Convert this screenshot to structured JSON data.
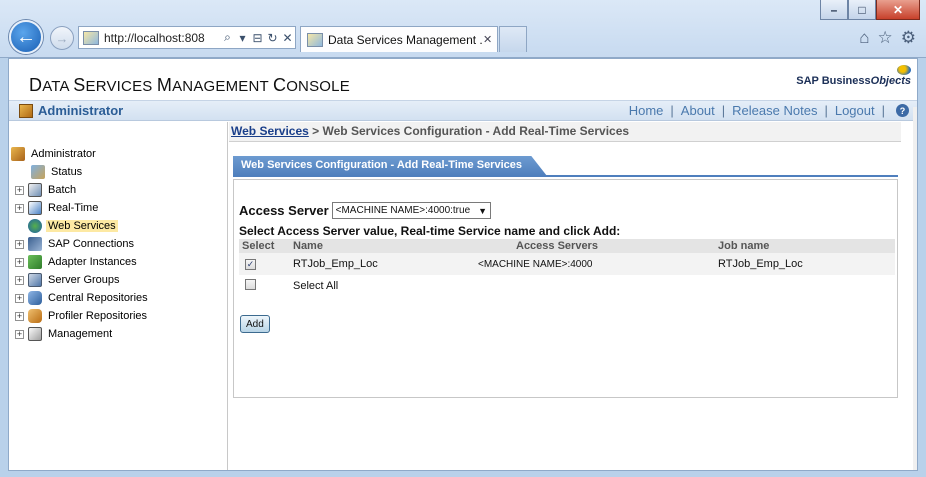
{
  "browser": {
    "url": "http://localhost:808",
    "tabs": [
      {
        "title": "Data Services Management ...",
        "active": true
      }
    ],
    "window_buttons": {
      "minimize": "–",
      "maximize": "□",
      "close": "✕"
    }
  },
  "app": {
    "title_big1": "D",
    "title_small1": "ATA ",
    "title_big2": "S",
    "title_small2": "ERVICES ",
    "title_big3": "M",
    "title_small3": "ANAGEMENT ",
    "title_big4": "C",
    "title_small4": "ONSOLE",
    "logo_text": "SAP Business",
    "logo_text2": "Objects"
  },
  "topnav": {
    "section": "Administrator",
    "links": [
      "Home",
      "About",
      "Release Notes",
      "Logout"
    ]
  },
  "tree": {
    "root": "Administrator",
    "items": [
      {
        "label": "Status",
        "expandable": false,
        "selected": false
      },
      {
        "label": "Batch",
        "expandable": true,
        "selected": false
      },
      {
        "label": "Real-Time",
        "expandable": true,
        "selected": false
      },
      {
        "label": "Web Services",
        "expandable": false,
        "selected": true
      },
      {
        "label": "SAP Connections",
        "expandable": true,
        "selected": false
      },
      {
        "label": "Adapter Instances",
        "expandable": true,
        "selected": false
      },
      {
        "label": "Server Groups",
        "expandable": true,
        "selected": false
      },
      {
        "label": "Central Repositories",
        "expandable": true,
        "selected": false
      },
      {
        "label": "Profiler Repositories",
        "expandable": true,
        "selected": false
      },
      {
        "label": "Management",
        "expandable": true,
        "selected": false
      }
    ]
  },
  "breadcrumb": {
    "link": "Web Services",
    "rest": "> Web Services Configuration - Add Real-Time Services"
  },
  "panel": {
    "tab_title": "Web Services Configuration - Add Real-Time Services",
    "access_server_label": "Access Server",
    "access_server_value": "<MACHINE NAME>:4000:true",
    "instruction": "Select Access Server value, Real-time Service name and click Add:",
    "columns": [
      "Select",
      "Name",
      "Access Servers",
      "Job name"
    ],
    "rows": [
      {
        "checked": true,
        "name": "RTJob_Emp_Loc",
        "access_server": "<MACHINE NAME>:4000",
        "job_name": "RTJob_Emp_Loc"
      }
    ],
    "select_all_label": "Select All",
    "add_button": "Add"
  },
  "colors": {
    "tab_blue": "#4f7fbd",
    "link_blue": "#4a79ad",
    "selection_yellow": "#fde9a3"
  }
}
